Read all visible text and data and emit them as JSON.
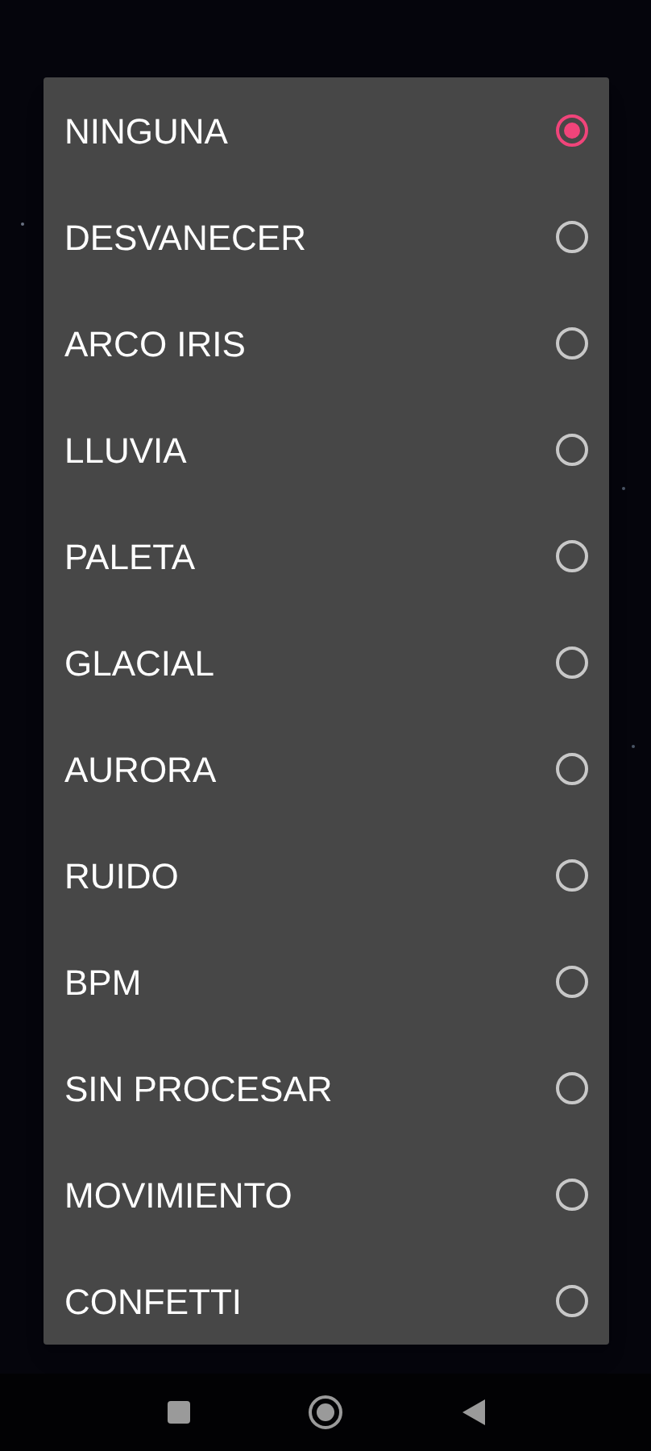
{
  "options": [
    {
      "label": "NINGUNA",
      "selected": true
    },
    {
      "label": "DESVANECER",
      "selected": false
    },
    {
      "label": "ARCO IRIS",
      "selected": false
    },
    {
      "label": "LLUVIA",
      "selected": false
    },
    {
      "label": "PALETA",
      "selected": false
    },
    {
      "label": "GLACIAL",
      "selected": false
    },
    {
      "label": "AURORA",
      "selected": false
    },
    {
      "label": "RUIDO",
      "selected": false
    },
    {
      "label": "BPM",
      "selected": false
    },
    {
      "label": "SIN PROCESAR",
      "selected": false
    },
    {
      "label": "MOVIMIENTO",
      "selected": false
    },
    {
      "label": "CONFETTI",
      "selected": false
    }
  ]
}
